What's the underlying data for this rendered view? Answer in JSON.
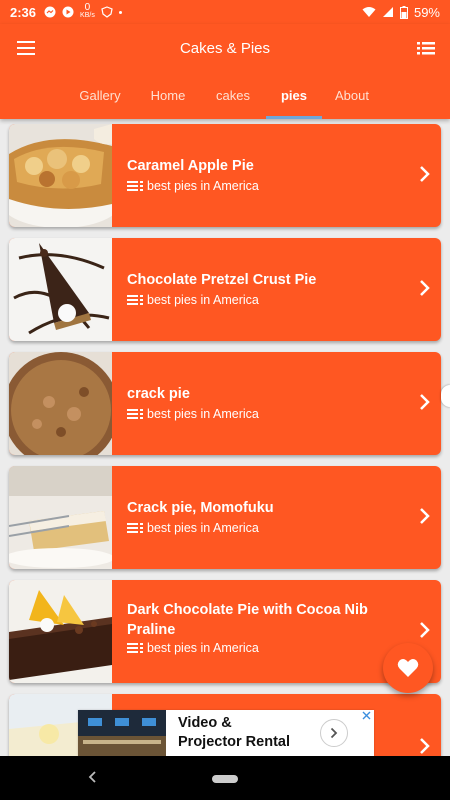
{
  "status": {
    "time": "2:36",
    "net_speed": "0",
    "net_unit": "KB/s",
    "battery": "59%"
  },
  "header": {
    "title": "Cakes & Pies",
    "tabs": [
      {
        "label": "Gallery"
      },
      {
        "label": "Home"
      },
      {
        "label": "cakes"
      },
      {
        "label": "pies"
      },
      {
        "label": "About"
      }
    ],
    "active_tab": "pies"
  },
  "items": [
    {
      "title": "Caramel Apple Pie",
      "subtitle": "best pies in America"
    },
    {
      "title": "Chocolate Pretzel Crust Pie",
      "subtitle": "best pies in America"
    },
    {
      "title": "crack pie",
      "subtitle": "best pies in America"
    },
    {
      "title": "Crack pie, Momofuku",
      "subtitle": "best pies in America"
    },
    {
      "title": "Dark Chocolate Pie with Cocoa Nib Praline",
      "subtitle": "best pies in America"
    }
  ],
  "ad": {
    "line1": "Video &",
    "line2": "Projector Rental"
  },
  "colors": {
    "primary": "#ff5722",
    "tab_indicator": "#6fa7d9"
  },
  "icons": {
    "menu": "hamburger-icon",
    "list": "list-icon",
    "chevron": "chevron-right-icon",
    "fab": "heart-icon"
  }
}
